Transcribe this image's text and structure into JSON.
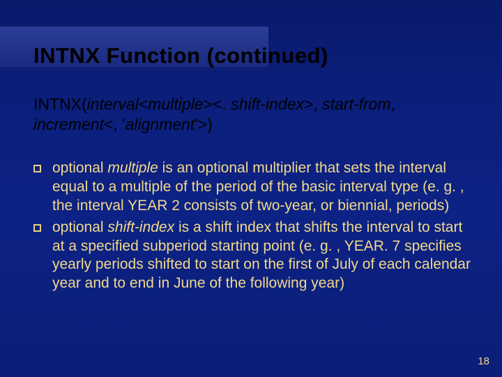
{
  "title": "INTNX Function (continued)",
  "syntax": {
    "fn": "INTNX(",
    "arg_interval": "interval",
    "lt1": "<",
    "arg_multiple": "multiple",
    "gt1": "><. ",
    "arg_shift": "shift-index",
    "gt2": ">, ",
    "arg_start": "start-from",
    "comma2": ", ",
    "arg_incr": "increment",
    "lt2": "<, '",
    "arg_align": "alignment",
    "tail": "'>)"
  },
  "bullets": [
    {
      "pre": "optional ",
      "kw": "multiple",
      "post": " is an optional multiplier that sets the interval equal to a multiple of the period of the basic interval type (e. g. ,  the interval YEAR 2 consists of two-year, or biennial, periods)"
    },
    {
      "pre": "optional ",
      "kw": "shift-index",
      "post": "  is a shift index that shifts the interval to start at a specified subperiod starting point (e. g. , YEAR. 7 specifies yearly periods shifted to start on the first of July of each calendar year and to end in June of the following year)"
    }
  ],
  "pagenum": "18"
}
